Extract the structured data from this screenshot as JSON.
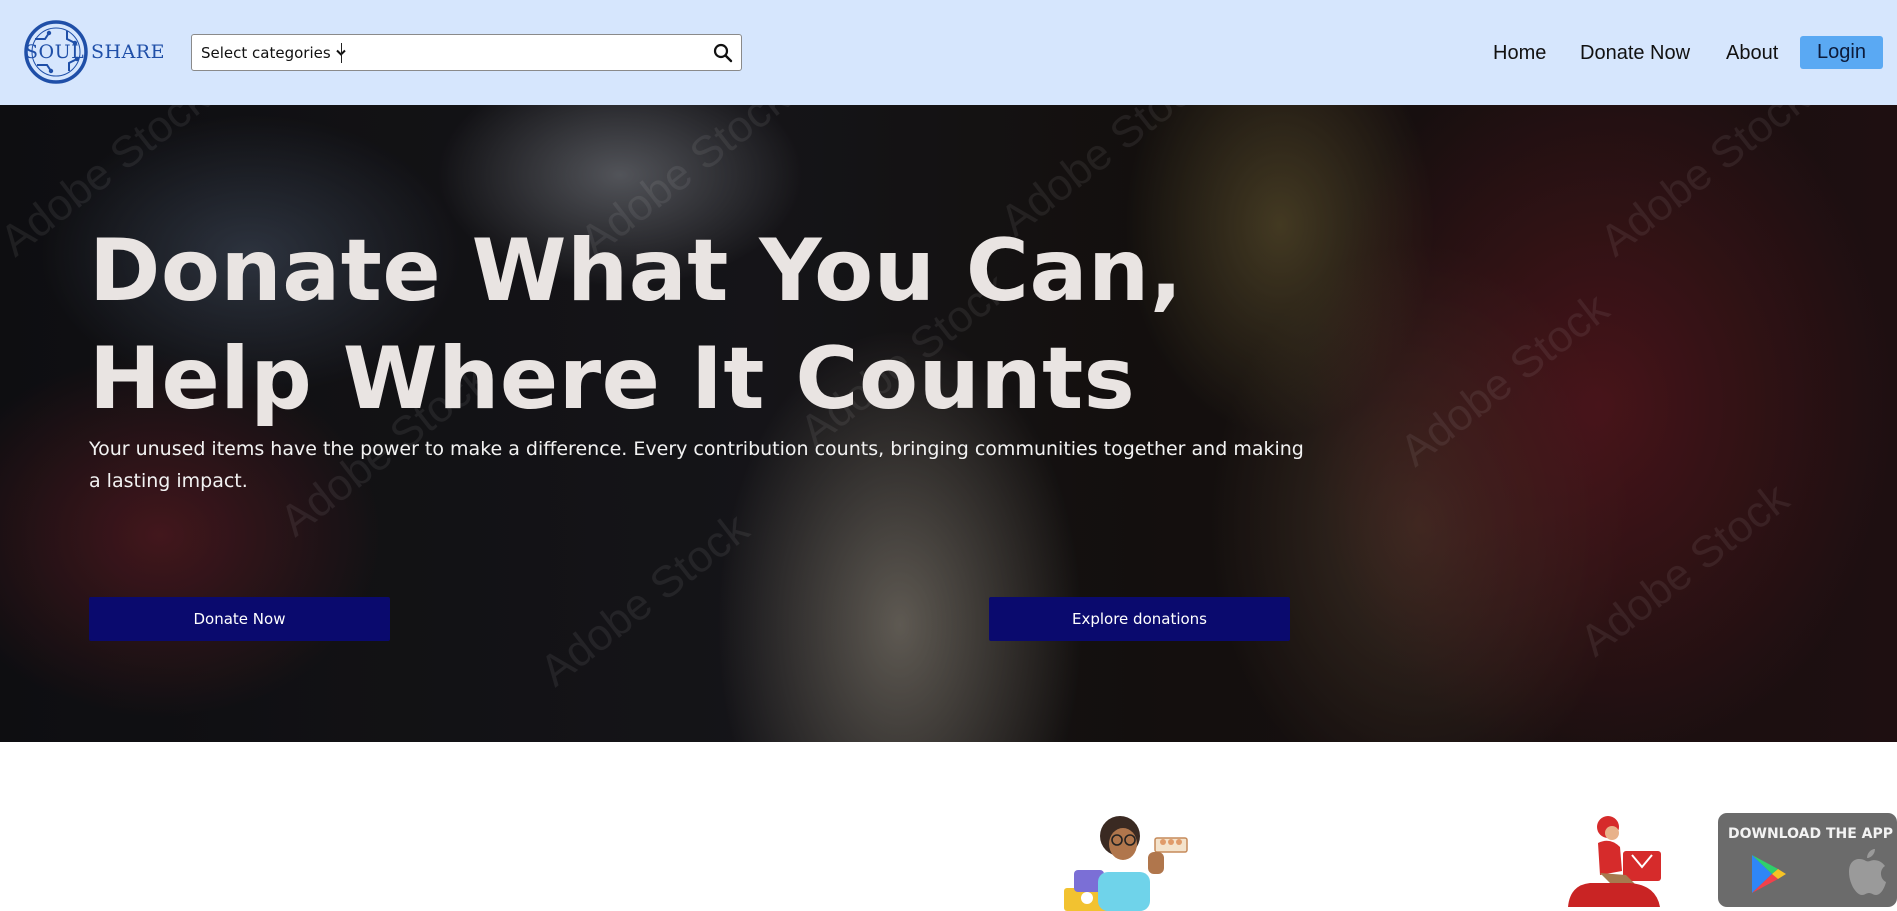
{
  "brand": {
    "logo_part1": "SOUL",
    "logo_part2": "SHARE"
  },
  "search": {
    "category_label": "Select categories",
    "placeholder": "",
    "value": ""
  },
  "nav": {
    "home": "Home",
    "donate_now": "Donate Now",
    "about": "About",
    "login": "Login"
  },
  "hero": {
    "title_line1": "Donate What You Can,",
    "title_line2": "Help Where It Counts",
    "subtitle": "Your unused items have the power to make a difference. Every contribution counts, bringing communities together and making a lasting impact.",
    "primary_button": "Donate Now",
    "secondary_button": "Explore donations"
  },
  "app_badge": {
    "label": "DOWNLOAD THE APP",
    "stores": [
      "google-play-icon",
      "apple-icon"
    ]
  },
  "colors": {
    "header_bg": "#d6e6fd",
    "login_bg": "#5aa9f3",
    "button_bg": "#0a0a6e",
    "logo_blue": "#1f4fa8",
    "badge_bg": "#6b6b6b"
  }
}
